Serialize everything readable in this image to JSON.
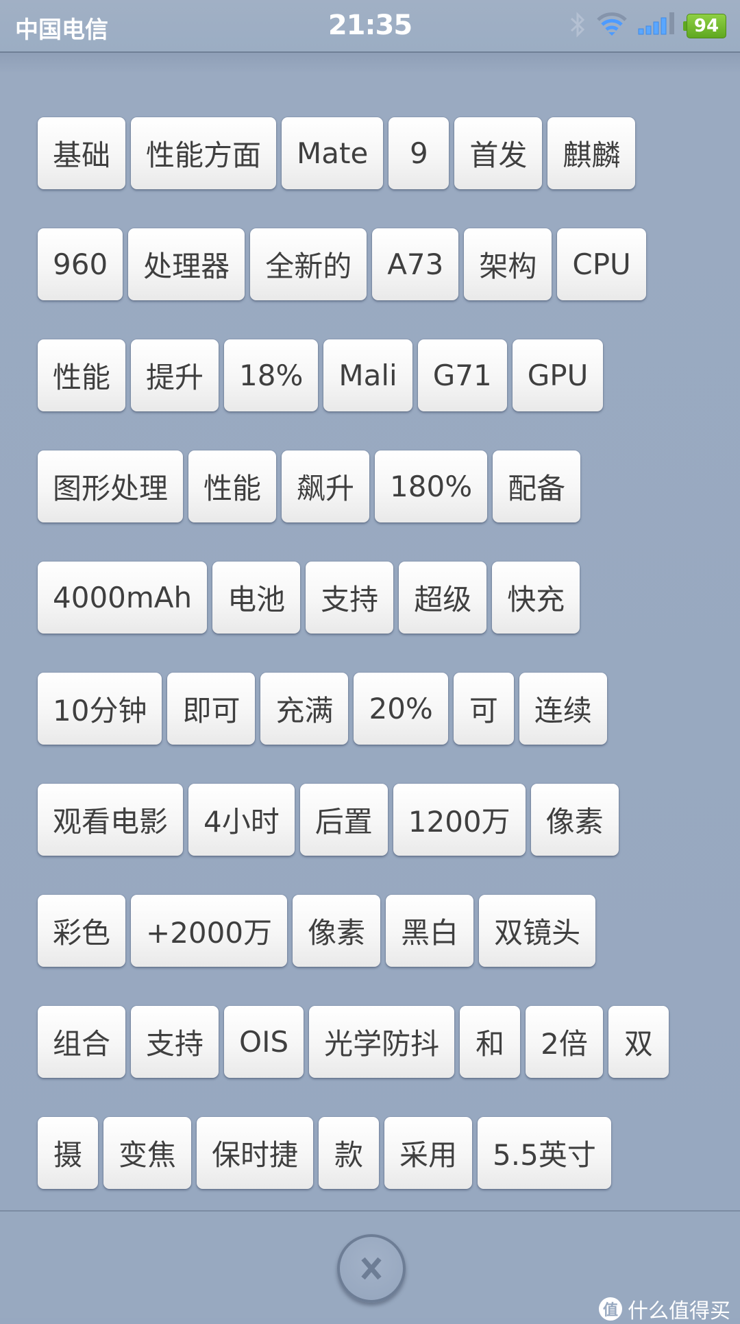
{
  "status_bar": {
    "carrier": "中国电信",
    "time": "21:35",
    "bluetooth_icon": "bluetooth-icon",
    "wifi_icon": "wifi-icon",
    "signal_icon": "signal-icon",
    "battery_level": "94",
    "battery_color": "#7cc033"
  },
  "tokens": {
    "rows": [
      [
        "基础",
        "性能方面",
        "Mate",
        "9",
        "首发",
        "麒麟"
      ],
      [
        "960",
        "处理器",
        "全新的",
        "A73",
        "架构",
        "CPU"
      ],
      [
        "性能",
        "提升",
        "18%",
        "Mali",
        "G71",
        "GPU"
      ],
      [
        "图形处理",
        "性能",
        "飙升",
        "180%",
        "配备"
      ],
      [
        "4000mAh",
        "电池",
        "支持",
        "超级",
        "快充"
      ],
      [
        "10分钟",
        "即可",
        "充满",
        "20%",
        "可",
        "连续"
      ],
      [
        "观看电影",
        "4小时",
        "后置",
        "1200万",
        "像素"
      ],
      [
        "彩色",
        "+2000万",
        "像素",
        "黑白",
        "双镜头"
      ],
      [
        "组合",
        "支持",
        "OIS",
        "光学防抖",
        "和",
        "2倍",
        "双"
      ],
      [
        "摄",
        "变焦",
        "保时捷",
        "款",
        "采用",
        "5.5英寸"
      ]
    ]
  },
  "bottom_bar": {
    "close_icon": "close-icon",
    "watermark_logo": "值",
    "watermark_text": "什么值得买"
  }
}
